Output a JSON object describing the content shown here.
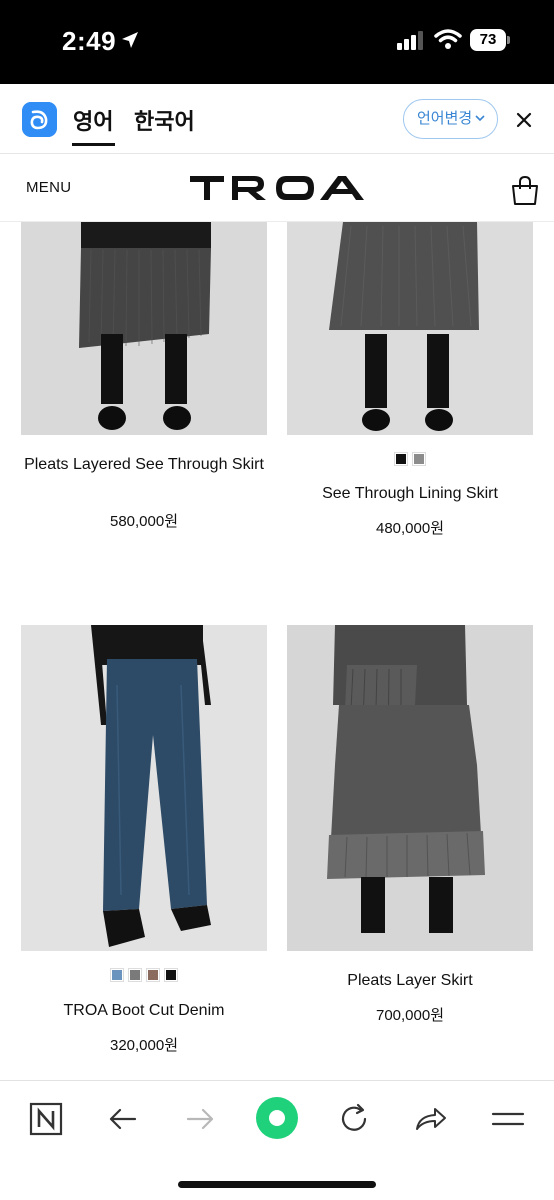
{
  "status_bar": {
    "time": "2:49",
    "battery": "73"
  },
  "translate_bar": {
    "tab_english": "영어",
    "tab_korean": "한국어",
    "change_language": "언어변경"
  },
  "header": {
    "menu": "MENU",
    "brand": "TROA"
  },
  "products": [
    {
      "name": "Pleats Layered See Through Skirt",
      "price": "580,000원",
      "swatches": []
    },
    {
      "name": "See Through Lining Skirt",
      "price": "480,000원",
      "swatches": [
        "#111111",
        "#8c8c8c"
      ]
    },
    {
      "name": "TROA Boot Cut Denim",
      "price": "320,000원",
      "swatches": [
        "#6a94bd",
        "#7a7a7a",
        "#8b6b5e",
        "#111111"
      ]
    },
    {
      "name": "Pleats Layer Skirt",
      "price": "700,000원",
      "swatches": []
    }
  ],
  "colors": {
    "accent_blue": "#2f8df5",
    "change_btn_text": "#3a86d4",
    "active_green": "#1ed17a"
  },
  "toolbar_icons": [
    "naver-icon",
    "back-arrow-icon",
    "forward-arrow-icon",
    "green-dot-icon",
    "refresh-icon",
    "share-icon",
    "menu-icon"
  ]
}
